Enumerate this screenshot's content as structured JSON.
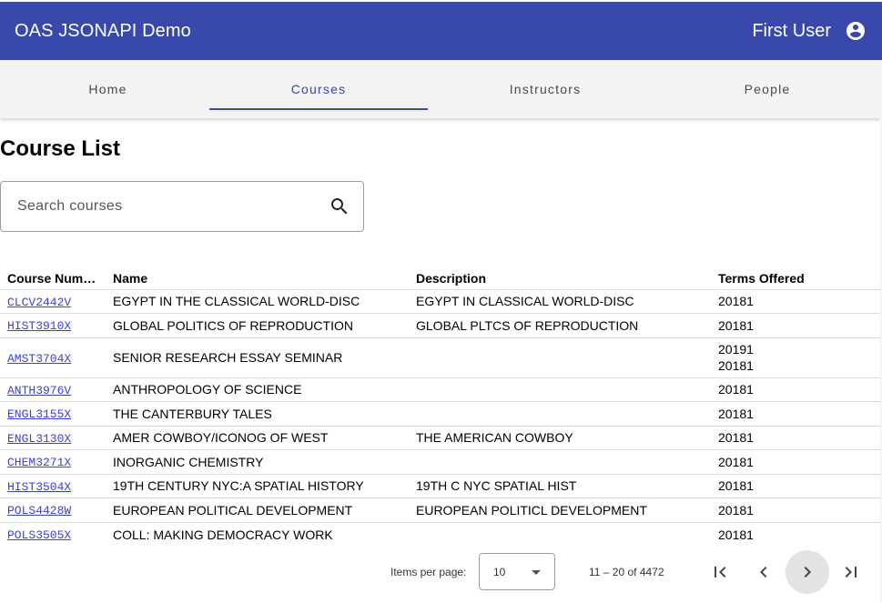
{
  "app": {
    "title": "OAS JSONAPI Demo",
    "user_name": "First User"
  },
  "icons": {
    "account": "account-circle-icon",
    "search": "search-icon",
    "first": "first-page-icon",
    "prev": "chevron-left-icon",
    "next": "chevron-right-icon",
    "last": "last-page-icon"
  },
  "colors": {
    "primary": "#3949ab",
    "link": "#3b40d8"
  },
  "tabs": [
    {
      "label": "Home",
      "active": false
    },
    {
      "label": "Courses",
      "active": true
    },
    {
      "label": "Instructors",
      "active": false
    },
    {
      "label": "People",
      "active": false
    }
  ],
  "page": {
    "title": "Course List"
  },
  "search": {
    "placeholder": "Search courses",
    "value": ""
  },
  "table": {
    "headers": [
      "Course Num…",
      "Name",
      "Description",
      "Terms Offered"
    ],
    "rows": [
      {
        "code": "CLCV2442V",
        "name": "EGYPT IN THE CLASSICAL WORLD-DISC",
        "description": "EGYPT IN CLASSICAL WORLD-DISC",
        "terms": [
          "20181"
        ]
      },
      {
        "code": "HIST3910X",
        "name": "GLOBAL POLITICS OF REPRODUCTION",
        "description": "GLOBAL PLTCS OF REPRODUCTION",
        "terms": [
          "20181"
        ]
      },
      {
        "code": "AMST3704X",
        "name": "SENIOR RESEARCH ESSAY SEMINAR",
        "description": "",
        "terms": [
          "20191",
          "20181"
        ]
      },
      {
        "code": "ANTH3976V",
        "name": "ANTHROPOLOGY OF SCIENCE",
        "description": "",
        "terms": [
          "20181"
        ]
      },
      {
        "code": "ENGL3155X",
        "name": "THE CANTERBURY TALES",
        "description": "",
        "terms": [
          "20181"
        ]
      },
      {
        "code": "ENGL3130X",
        "name": "AMER COWBOY/ICONOG OF WEST",
        "description": "THE AMERICAN COWBOY",
        "terms": [
          "20181"
        ]
      },
      {
        "code": "CHEM3271X",
        "name": "INORGANIC CHEMISTRY",
        "description": "",
        "terms": [
          "20181"
        ]
      },
      {
        "code": "HIST3504X",
        "name": "19TH CENTURY NYC:A SPATIAL HISTORY",
        "description": "19TH C NYC SPATIAL HIST",
        "terms": [
          "20181"
        ]
      },
      {
        "code": "POLS4428W",
        "name": "EUROPEAN POLITICAL DEVELOPMENT",
        "description": "EUROPEAN POLITICL DEVELOPMENT",
        "terms": [
          "20181"
        ]
      },
      {
        "code": "POLS3505X",
        "name": "COLL: MAKING DEMOCRACY WORK",
        "description": "",
        "terms": [
          "20181"
        ]
      }
    ]
  },
  "paginator": {
    "items_per_page_label": "Items per page:",
    "items_per_page": "10",
    "range_label": "11 – 20 of 4472"
  }
}
